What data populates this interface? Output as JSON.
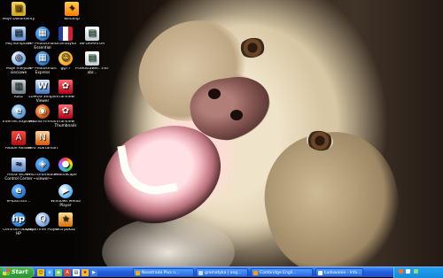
{
  "desktop": {
    "icons": [
      {
        "label": "Moje Dokumenty",
        "icon": "folder-icon"
      },
      {
        "label": "Mój komputer",
        "icon": "computer-icon"
      },
      {
        "label": "Moje miejsca sieciowe",
        "icon": "network-icon"
      },
      {
        "label": "Kosz",
        "icon": "trash-icon"
      },
      {
        "label": "Internet Explorer",
        "icon": "ie-icon"
      },
      {
        "label": "Adobe Reader",
        "icon": "acrobat-icon"
      },
      {
        "label": "ASUS WLAN Control Center",
        "icon": "wlan-icon"
      },
      {
        "label": "ePlus6.4th...",
        "icon": "hp-icon"
      },
      {
        "label": "Centrum obsługi HP",
        "icon": "hp-icon"
      },
      {
        "label": "Winamp",
        "icon": "winamp-icon"
      },
      {
        "label": "HP Photosmart Essential",
        "icon": "hp-icon"
      },
      {
        "label": "HP Photosmart Express",
        "icon": "hp-icon"
      },
      {
        "label": "LUMOS Simple Viewer",
        "icon": "word-icon"
      },
      {
        "label": "Mozilla Firefox",
        "icon": "firefox-icon"
      },
      {
        "label": "Nero StartSmart",
        "icon": "nero-icon"
      },
      {
        "label": "PHOTOfunStudio ~viewer~",
        "icon": "hp-icon"
      },
      {
        "label": "QuickTime Player",
        "icon": "quicktime-icon"
      },
      {
        "label": "Gramatyka",
        "icon": "flag-icon"
      },
      {
        "label": "gg77",
        "icon": "gg-icon"
      },
      {
        "label": "IrfanView",
        "icon": "irfan-icon"
      },
      {
        "label": "INFORMATOR",
        "icon": "doc-icon"
      },
      {
        "label": "Przedstawie...nich obr...",
        "icon": "doc-icon"
      },
      {
        "label": "IrfanView Thumbnails",
        "icon": "irfan-icon"
      },
      {
        "label": "PhotoScape",
        "icon": "photoscape-icon"
      },
      {
        "label": "Windows Media Player",
        "icon": "media-icon"
      },
      {
        "label": "Gra pokaz",
        "icon": "wgames-icon"
      },
      {
        "label": "Nero StartSmart",
        "icon": "nero-icon"
      }
    ]
  },
  "taskbar": {
    "start_label": "Start",
    "tasks": [
      {
        "label": "Neostrada Plus n..."
      },
      {
        "label": "gramatyka | ang..."
      },
      {
        "label": "Cambridge Engli..."
      },
      {
        "label": "Ładowanie - Info..."
      }
    ],
    "tray_time": ""
  }
}
